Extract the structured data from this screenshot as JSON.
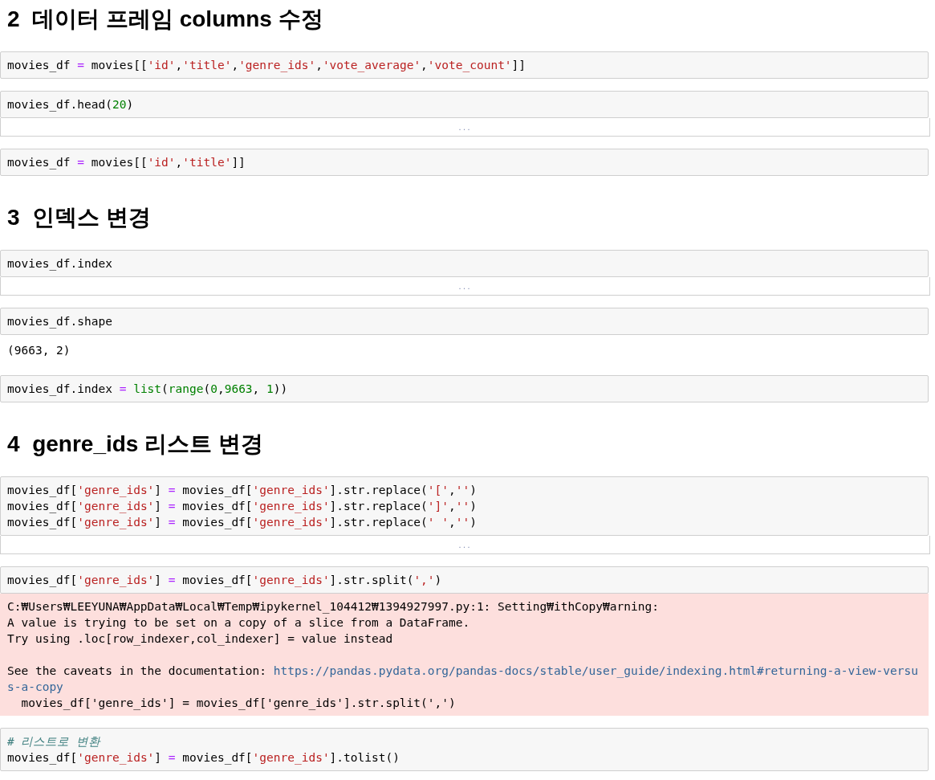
{
  "cells": [
    {
      "kind": "heading",
      "text": "2  데이터 프레임 columns 수정"
    },
    {
      "kind": "code",
      "lines": [
        [
          {
            "kind": "plain",
            "text": "movies_df "
          },
          {
            "kind": "op",
            "text": "="
          },
          {
            "kind": "plain",
            "text": " movies[["
          },
          {
            "kind": "str",
            "text": "'id'"
          },
          {
            "kind": "plain",
            "text": ","
          },
          {
            "kind": "str",
            "text": "'title'"
          },
          {
            "kind": "plain",
            "text": ","
          },
          {
            "kind": "str",
            "text": "'genre_ids'"
          },
          {
            "kind": "plain",
            "text": ","
          },
          {
            "kind": "str",
            "text": "'vote_average'"
          },
          {
            "kind": "plain",
            "text": ","
          },
          {
            "kind": "str",
            "text": "'vote_count'"
          },
          {
            "kind": "plain",
            "text": "]]"
          }
        ]
      ]
    },
    {
      "kind": "code",
      "lines": [
        [
          {
            "kind": "plain",
            "text": "movies_df.head("
          },
          {
            "kind": "num",
            "text": "20"
          },
          {
            "kind": "plain",
            "text": ")"
          }
        ]
      ]
    },
    {
      "kind": "collapsed",
      "text": "..."
    },
    {
      "kind": "code",
      "lines": [
        [
          {
            "kind": "plain",
            "text": "movies_df "
          },
          {
            "kind": "op",
            "text": "="
          },
          {
            "kind": "plain",
            "text": " movies[["
          },
          {
            "kind": "str",
            "text": "'id'"
          },
          {
            "kind": "plain",
            "text": ","
          },
          {
            "kind": "str",
            "text": "'title'"
          },
          {
            "kind": "plain",
            "text": "]]"
          }
        ]
      ]
    },
    {
      "kind": "heading",
      "text": "3  인덱스 변경"
    },
    {
      "kind": "code",
      "lines": [
        [
          {
            "kind": "plain",
            "text": "movies_df.index"
          }
        ]
      ]
    },
    {
      "kind": "collapsed",
      "text": "..."
    },
    {
      "kind": "code",
      "lines": [
        [
          {
            "kind": "plain",
            "text": "movies_df.shape"
          }
        ]
      ]
    },
    {
      "kind": "output",
      "text": "(9663, 2)"
    },
    {
      "kind": "code",
      "lines": [
        [
          {
            "kind": "plain",
            "text": "movies_df.index "
          },
          {
            "kind": "op",
            "text": "="
          },
          {
            "kind": "builtin",
            "text": " list"
          },
          {
            "kind": "plain",
            "text": "("
          },
          {
            "kind": "builtin",
            "text": "range"
          },
          {
            "kind": "plain",
            "text": "("
          },
          {
            "kind": "num",
            "text": "0"
          },
          {
            "kind": "plain",
            "text": ","
          },
          {
            "kind": "num",
            "text": "9663"
          },
          {
            "kind": "plain",
            "text": ", "
          },
          {
            "kind": "num",
            "text": "1"
          },
          {
            "kind": "plain",
            "text": "))"
          }
        ]
      ]
    },
    {
      "kind": "heading",
      "text": "4  genre_ids 리스트 변경"
    },
    {
      "kind": "code",
      "lines": [
        [
          {
            "kind": "plain",
            "text": "movies_df["
          },
          {
            "kind": "str",
            "text": "'genre_ids'"
          },
          {
            "kind": "plain",
            "text": "] "
          },
          {
            "kind": "op",
            "text": "="
          },
          {
            "kind": "plain",
            "text": " movies_df["
          },
          {
            "kind": "str",
            "text": "'genre_ids'"
          },
          {
            "kind": "plain",
            "text": "].str.replace("
          },
          {
            "kind": "str",
            "text": "'['"
          },
          {
            "kind": "plain",
            "text": ","
          },
          {
            "kind": "str",
            "text": "''"
          },
          {
            "kind": "plain",
            "text": ")"
          }
        ],
        [
          {
            "kind": "plain",
            "text": "movies_df["
          },
          {
            "kind": "str",
            "text": "'genre_ids'"
          },
          {
            "kind": "plain",
            "text": "] "
          },
          {
            "kind": "op",
            "text": "="
          },
          {
            "kind": "plain",
            "text": " movies_df["
          },
          {
            "kind": "str",
            "text": "'genre_ids'"
          },
          {
            "kind": "plain",
            "text": "].str.replace("
          },
          {
            "kind": "str",
            "text": "']'"
          },
          {
            "kind": "plain",
            "text": ","
          },
          {
            "kind": "str",
            "text": "''"
          },
          {
            "kind": "plain",
            "text": ")"
          }
        ],
        [
          {
            "kind": "plain",
            "text": "movies_df["
          },
          {
            "kind": "str",
            "text": "'genre_ids'"
          },
          {
            "kind": "plain",
            "text": "] "
          },
          {
            "kind": "op",
            "text": "="
          },
          {
            "kind": "plain",
            "text": " movies_df["
          },
          {
            "kind": "str",
            "text": "'genre_ids'"
          },
          {
            "kind": "plain",
            "text": "].str.replace("
          },
          {
            "kind": "str",
            "text": "' '"
          },
          {
            "kind": "plain",
            "text": ","
          },
          {
            "kind": "str",
            "text": "''"
          },
          {
            "kind": "plain",
            "text": ")"
          }
        ]
      ]
    },
    {
      "kind": "collapsed",
      "text": "..."
    },
    {
      "kind": "code",
      "lines": [
        [
          {
            "kind": "plain",
            "text": "movies_df["
          },
          {
            "kind": "str",
            "text": "'genre_ids'"
          },
          {
            "kind": "plain",
            "text": "] "
          },
          {
            "kind": "op",
            "text": "="
          },
          {
            "kind": "plain",
            "text": " movies_df["
          },
          {
            "kind": "str",
            "text": "'genre_ids'"
          },
          {
            "kind": "plain",
            "text": "].str.split("
          },
          {
            "kind": "str",
            "text": "','"
          },
          {
            "kind": "plain",
            "text": ")"
          }
        ]
      ]
    },
    {
      "kind": "stderr",
      "lines": [
        "C:₩Users₩LEEYUNA₩AppData₩Local₩Temp₩ipykernel_104412₩1394927997.py:1: Setting₩ithCopy₩arning:",
        "A value is trying to be set on a copy of a slice from a DataFrame.",
        "Try using .loc[row_indexer,col_indexer] = value instead"
      ],
      "note": "See the caveats in the documentation: ",
      "link_lines": [
        "https://pandas.pydata.org/pandas-docs/stable/user_guide/indexing.html#returning-a-view-versu",
        "s-a-copy"
      ],
      "source_line": "  movies_df['genre_ids'] = movies_df['genre_ids'].str.split(',')"
    },
    {
      "kind": "code",
      "lines": [
        [
          {
            "kind": "comment",
            "text": "# 리스트로 변환"
          }
        ],
        [
          {
            "kind": "plain",
            "text": "movies_df["
          },
          {
            "kind": "str",
            "text": "'genre_ids'"
          },
          {
            "kind": "plain",
            "text": "] "
          },
          {
            "kind": "op",
            "text": "="
          },
          {
            "kind": "plain",
            "text": " movies_df["
          },
          {
            "kind": "str",
            "text": "'genre_ids'"
          },
          {
            "kind": "plain",
            "text": "].tolist()"
          }
        ]
      ]
    }
  ]
}
